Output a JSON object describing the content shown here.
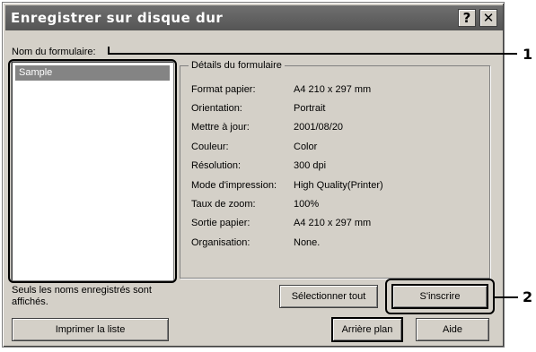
{
  "dialog": {
    "title": "Enregistrer sur disque dur",
    "help_button": "?",
    "close_button": "✕"
  },
  "form_name_label": "Nom du formulaire:",
  "forms_list": [
    {
      "label": "Sample",
      "selected": true
    }
  ],
  "details": {
    "group_label": "Détails du formulaire",
    "rows": [
      {
        "key": "Format papier:",
        "value": "A4 210 x 297 mm"
      },
      {
        "key": "Orientation:",
        "value": "Portrait"
      },
      {
        "key": "Mettre à jour:",
        "value": "2001/08/20"
      },
      {
        "key": "Couleur:",
        "value": "Color"
      },
      {
        "key": "Résolution:",
        "value": "300 dpi"
      },
      {
        "key": "Mode d'impression:",
        "value": "High Quality(Printer)"
      },
      {
        "key": "Taux de zoom:",
        "value": "100%"
      },
      {
        "key": "Sortie papier:",
        "value": "A4 210 x 297 mm"
      },
      {
        "key": "Organisation:",
        "value": "None."
      }
    ]
  },
  "note": {
    "line1": "Seuls les noms enregistrés sont",
    "line2": "affichés."
  },
  "buttons": {
    "select_all": "Sélectionner tout",
    "register": "S'inscrire",
    "print_list": "Imprimer la liste",
    "background": "Arrière plan",
    "help": "Aide"
  },
  "callouts": [
    "1",
    "2"
  ]
}
